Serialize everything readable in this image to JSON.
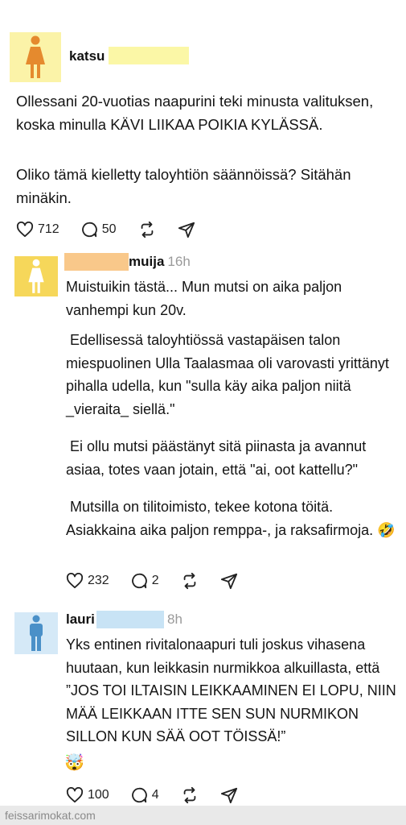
{
  "post": {
    "username": "katsu",
    "text_1": "Ollessani 20-vuotias naapurini teki minusta valituksen, koska minulla KÄVI LIIKAA POIKIA KYLÄSSÄ.",
    "text_2": "Oliko tämä kielletty taloyhtiön säännöissä? Sitähän minäkin.",
    "likes": "712",
    "comments": "50"
  },
  "reply1": {
    "username": "muija",
    "time": "16h",
    "text_1": "Muistuikin tästä... Mun mutsi on aika paljon vanhempi kun 20v.",
    "text_2": " Edellisessä taloyhtiössä vastapäisen talon miespuolinen Ulla Taalasmaa oli varovasti yrittänyt pihalla udella, kun \"sulla käy aika paljon niitä _vieraita_ siellä.\"",
    "text_3": " Ei ollu mutsi päästänyt sitä piinasta ja avannut asiaa, totes vaan jotain, että \"ai, oot kattellu?\"",
    "text_4": " Mutsilla on tilitoimisto, tekee kotona töitä. Asiakkaina aika paljon remppa-, ja raksafirmoja. 🤣",
    "likes": "232",
    "comments": "2"
  },
  "reply2": {
    "username": "lauri",
    "time": "8h",
    "text_1": "Yks entinen rivitalonaapuri tuli joskus vihasena huutaan, kun leikkasin nurmikkoa alkuillasta, että ”JOS TOI ILTAISIN LEIKKAAMINEN EI LOPU, NIIN MÄÄ LEIKKAAN ITTE SEN SUN NURMIKON SILLON KUN SÄÄ OOT TÖISSÄ!”",
    "emoji": "🤯",
    "likes": "100",
    "comments": "4"
  },
  "watermark": "feissarimokat.com",
  "colors": {
    "avatar_female_bg": "#fbf3a8",
    "avatar_female2_bg": "#f6d75a",
    "avatar_male_bg": "#d5e9f7",
    "female_icon": "#e58a2e",
    "male_icon": "#4a90c8",
    "muted": "#9a9a9a"
  },
  "icons": [
    "female-avatar-icon",
    "male-avatar-icon",
    "heart-icon",
    "comment-icon",
    "repost-icon",
    "share-icon"
  ]
}
